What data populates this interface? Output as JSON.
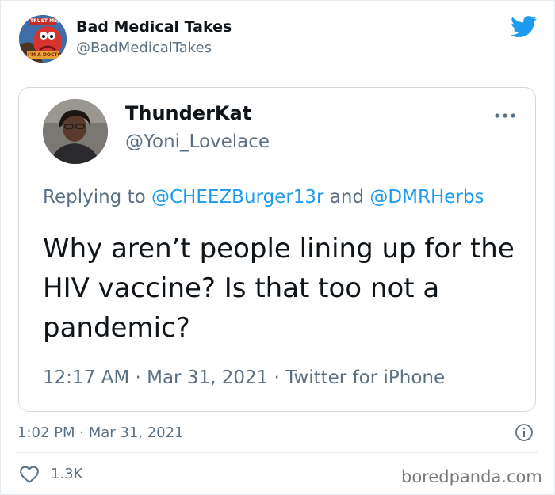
{
  "tweet": {
    "author_name": "Bad Medical Takes",
    "author_handle": "@BadMedicalTakes",
    "avatar_badge_top": "TRUST ME,",
    "avatar_badge_bottom": "I'M A DOCTOR",
    "timestamp": "1:02 PM · Mar 31, 2021",
    "likes": "1.3K"
  },
  "quoted": {
    "author_name": "ThunderKat",
    "author_handle": "@Yoni_Lovelace",
    "replying_prefix": "Replying to ",
    "mention_1": "@CHEEZBurger13r",
    "and_word": " and ",
    "mention_2": "@DMRHerbs",
    "text": "Why aren’t people lining up for the HIV vaccine? Is that too not a pandemic?",
    "meta": "12:17 AM · Mar 31, 2021 · Twitter for iPhone"
  },
  "watermark": "boredpanda.com",
  "icons": {
    "brand": "twitter-bird-icon",
    "more": "more-options-icon",
    "info": "info-icon",
    "like": "heart-icon"
  },
  "colors": {
    "twitter_blue": "#1d9bf0",
    "secondary_text": "#5b7083",
    "border": "#cfd9de"
  }
}
